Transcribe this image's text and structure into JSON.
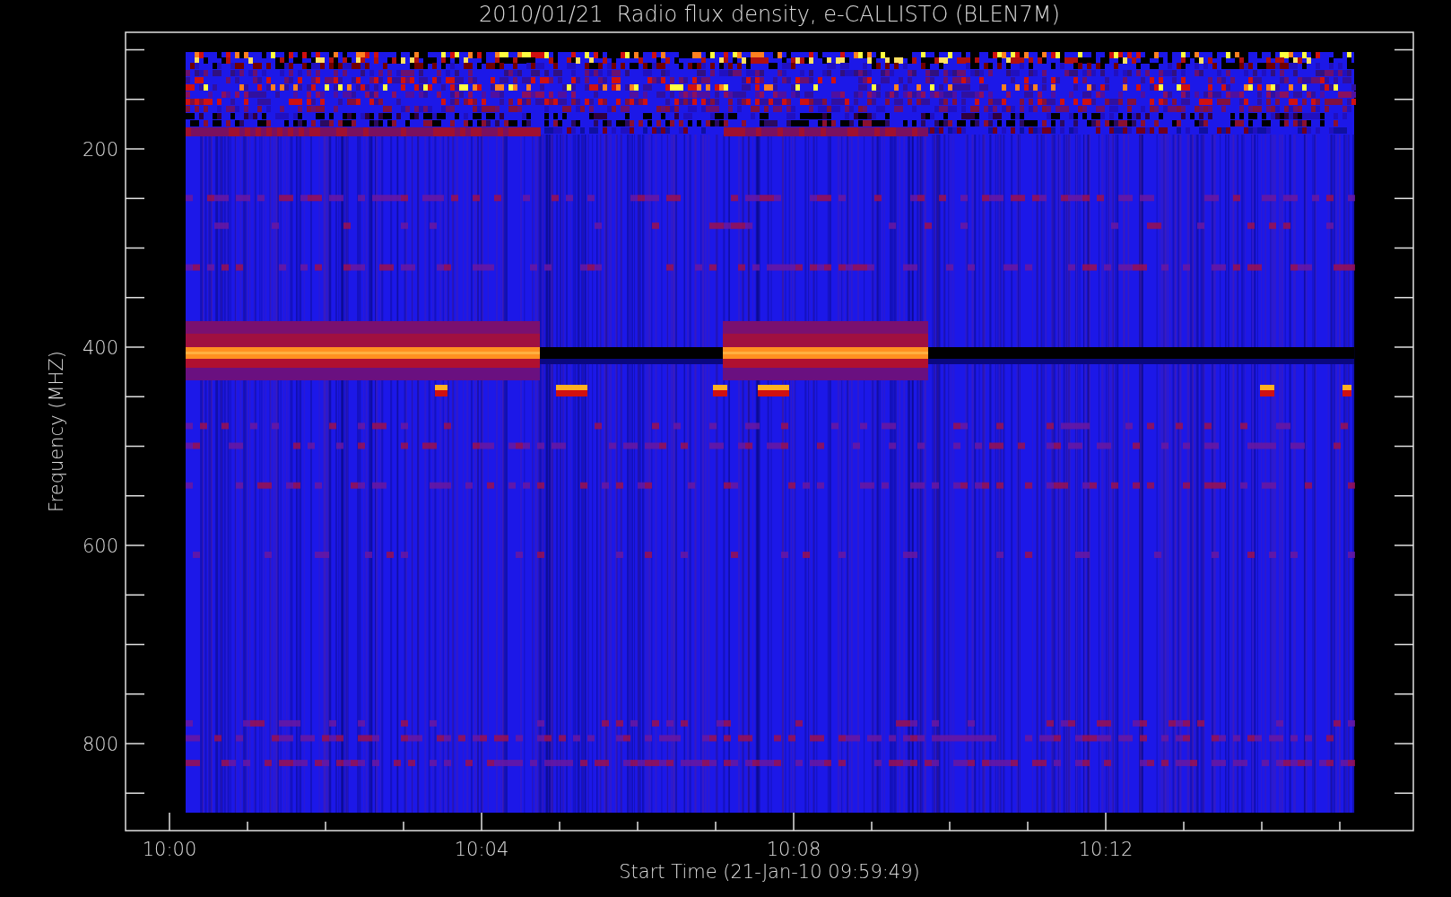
{
  "title": "2010/01/21  Radio flux density, e-CALLISTO (BLEN7M)",
  "y_axis": {
    "label": "Frequency (MHZ)",
    "ticks": [
      "200",
      "400",
      "600",
      "800"
    ]
  },
  "x_axis": {
    "label": "Start Time (21-Jan-10 09:59:49)",
    "ticks": [
      "10:00",
      "10:04",
      "10:08",
      "10:12"
    ]
  }
}
